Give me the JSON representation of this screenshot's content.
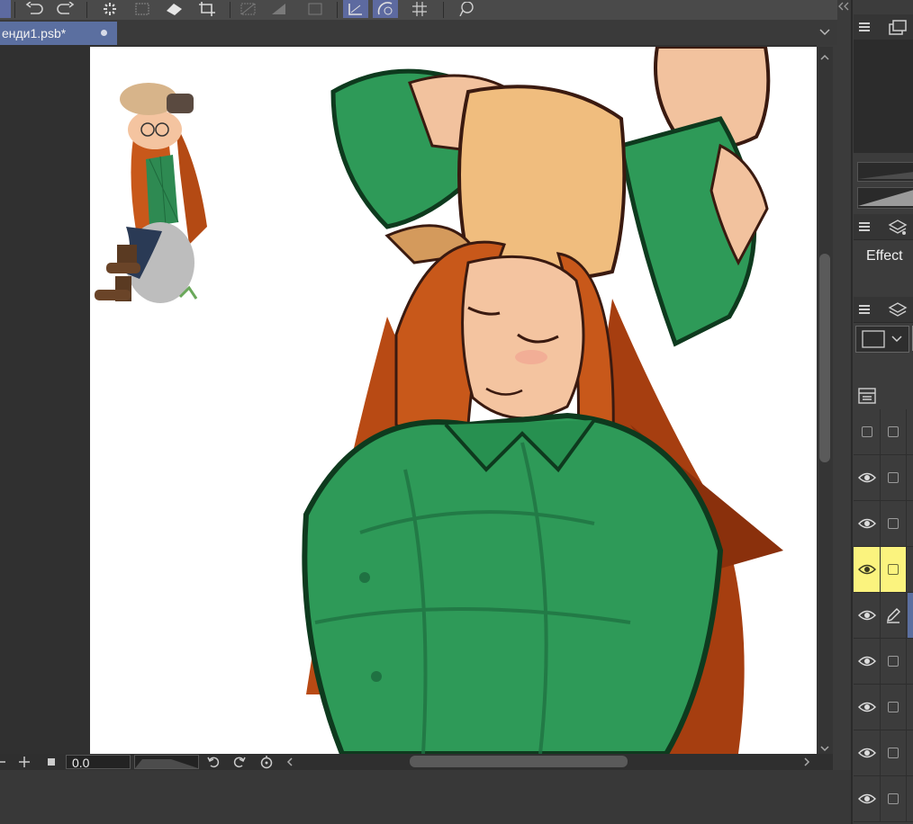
{
  "document": {
    "tab_title": "енди1.psb*"
  },
  "canvas": {
    "zoom_value": "0.0"
  },
  "panels": {
    "effect_label": "Effect"
  },
  "layers": {
    "rows": [
      {
        "visible": false,
        "selected": false,
        "icon": "checkbox"
      },
      {
        "visible": true,
        "selected": false,
        "icon": "checkbox"
      },
      {
        "visible": true,
        "selected": false,
        "icon": "checkbox"
      },
      {
        "visible": true,
        "selected": true,
        "icon": "checkbox"
      },
      {
        "visible": true,
        "selected": false,
        "icon": "pen-icon"
      },
      {
        "visible": true,
        "selected": false,
        "icon": "checkbox"
      },
      {
        "visible": true,
        "selected": false,
        "icon": "checkbox"
      },
      {
        "visible": true,
        "selected": false,
        "icon": "checkbox"
      },
      {
        "visible": true,
        "selected": false,
        "icon": "checkbox"
      }
    ]
  },
  "colors": {
    "accent": "#5b6fa0",
    "selected_layer": "#fbf37e",
    "shirt": "#2e9a58",
    "hair": "#c8581a",
    "skin": "#f4c4a0",
    "hat": "#f0bd7e"
  }
}
